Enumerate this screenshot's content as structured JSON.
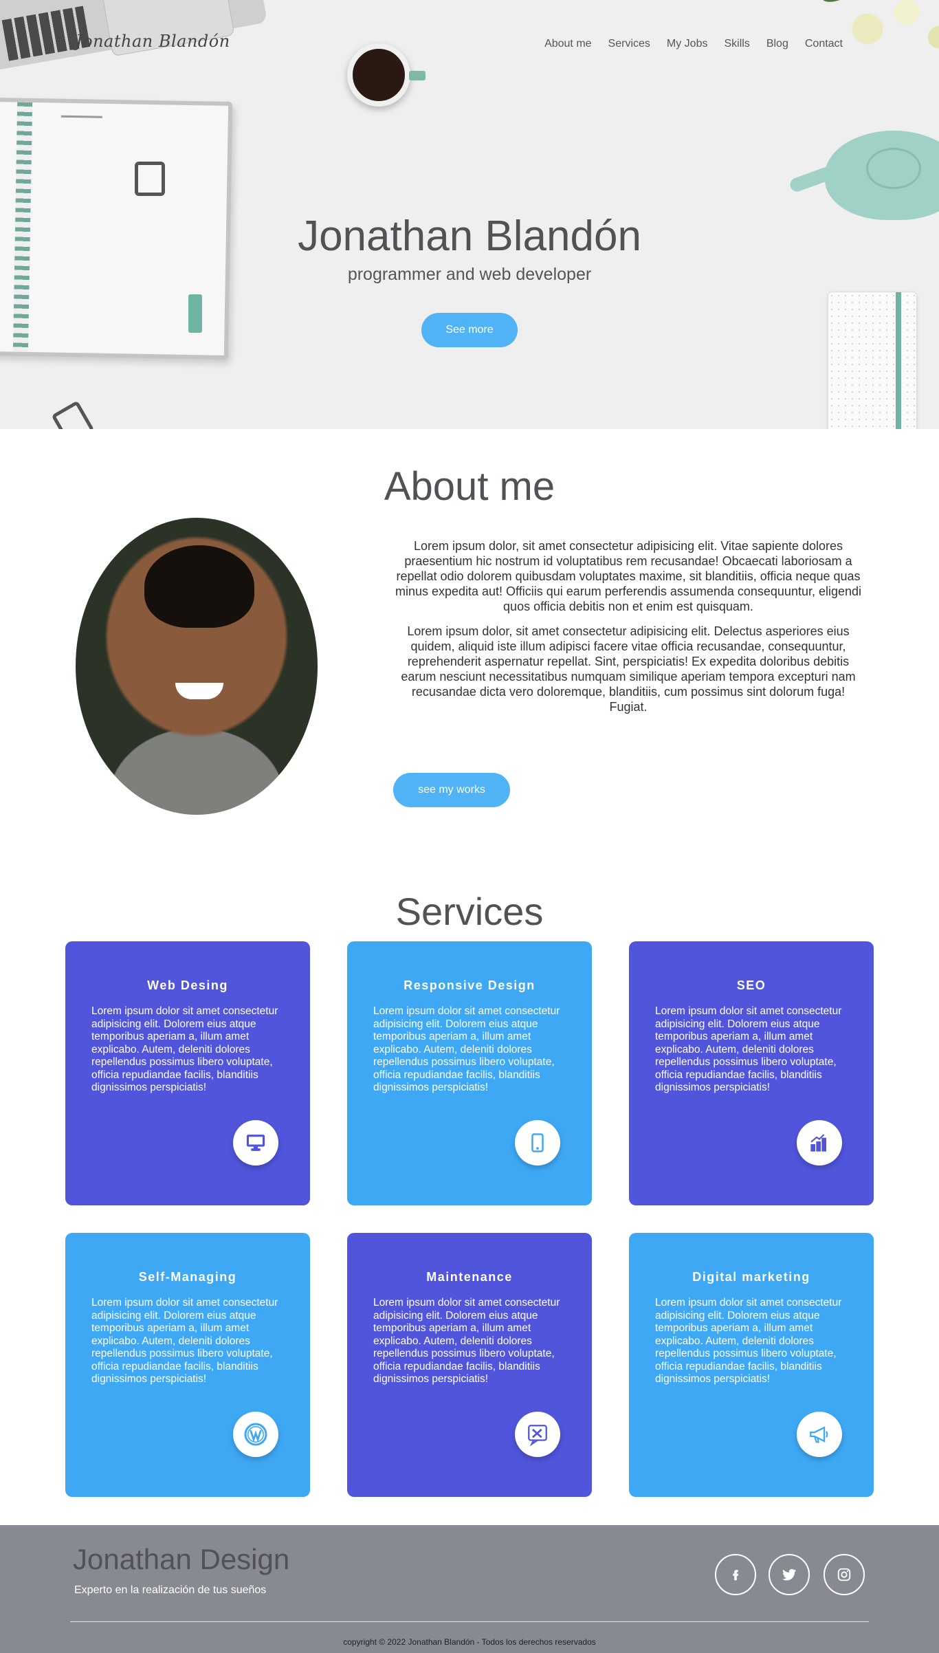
{
  "header": {
    "logo": "Jonathan Blandón",
    "nav": [
      "About me",
      "Services",
      "My Jobs",
      "Skills",
      "Blog",
      "Contact"
    ]
  },
  "hero": {
    "title": "Jonathan Blandón",
    "subtitle": "programmer and web developer",
    "button": "See more"
  },
  "about": {
    "title": "About me",
    "paragraphs": [
      "Lorem ipsum dolor, sit amet consectetur adipisicing elit. Vitae sapiente dolores praesentium hic nostrum id voluptatibus rem recusandae! Obcaecati laboriosam a repellat odio dolorem quibusdam voluptates maxime, sit blanditiis, officia neque quas minus expedita aut! Officiis qui earum perferendis assumenda consequuntur, eligendi quos officia debitis non et enim est quisquam.",
      "Lorem ipsum dolor, sit amet consectetur adipisicing elit. Delectus asperiores eius quidem, aliquid iste illum adipisci facere vitae officia recusandae, consequuntur, reprehenderit aspernatur repellat. Sint, perspiciatis! Ex expedita doloribus debitis earum nesciunt necessitatibus numquam similique aperiam tempora excepturi nam recusandae dicta vero doloremque, blanditiis, cum possimus sint dolorum fuga! Fugiat."
    ],
    "button": "see my works"
  },
  "services": {
    "title": "Services",
    "cards": [
      {
        "title": "Web Desing",
        "text": "Lorem ipsum dolor sit amet consectetur adipisicing elit. Dolorem eius atque temporibus aperiam a, illum amet explicabo. Autem, deleniti dolores repellendus possimus libero voluptate, officia repudiandae facilis, blanditiis dignissimos perspiciatis!",
        "icon": "monitor-icon",
        "color": "#5055dc"
      },
      {
        "title": "Responsive Design",
        "text": "Lorem ipsum dolor sit amet consectetur adipisicing elit. Dolorem eius atque temporibus aperiam a, illum amet explicabo. Autem, deleniti dolores repellendus possimus libero voluptate, officia repudiandae facilis, blanditiis dignissimos perspiciatis!",
        "icon": "smartphone-icon",
        "color": "#3ea8f5"
      },
      {
        "title": "SEO",
        "text": "Lorem ipsum dolor sit amet consectetur adipisicing elit. Dolorem eius atque temporibus aperiam a, illum amet explicabo. Autem, deleniti dolores repellendus possimus libero voluptate, officia repudiandae facilis, blanditiis dignissimos perspiciatis!",
        "icon": "growth-chart-icon",
        "color": "#5055dc"
      },
      {
        "title": "Self-Managing",
        "text": "Lorem ipsum dolor sit amet consectetur adipisicing elit. Dolorem eius atque temporibus aperiam a, illum amet explicabo. Autem, deleniti dolores repellendus possimus libero voluptate, officia repudiandae facilis, blanditiis dignissimos perspiciatis!",
        "icon": "wordpress-icon",
        "color": "#3ea8f5"
      },
      {
        "title": "Maintenance",
        "text": "Lorem ipsum dolor sit amet consectetur adipisicing elit. Dolorem eius atque temporibus aperiam a, illum amet explicabo. Autem, deleniti dolores repellendus possimus libero voluptate, officia repudiandae facilis, blanditiis dignissimos perspiciatis!",
        "icon": "tools-icon",
        "color": "#5055dc"
      },
      {
        "title": "Digital marketing",
        "text": "Lorem ipsum dolor sit amet consectetur adipisicing elit. Dolorem eius atque temporibus aperiam a, illum amet explicabo. Autem, deleniti dolores repellendus possimus libero voluptate, officia repudiandae facilis, blanditiis dignissimos perspiciatis!",
        "icon": "megaphone-icon",
        "color": "#3ea8f5"
      }
    ]
  },
  "footer": {
    "brand": "Jonathan Design",
    "tagline": "Experto en la realización de tus sueños",
    "social": [
      "facebook-icon",
      "twitter-icon",
      "instagram-icon"
    ],
    "copyright": "copyright © 2022 Jonathan Blandón - Todos los derechos reservados",
    "background": "#878a91"
  },
  "colors": {
    "accent": "#4fb3f5",
    "purple": "#5055dc",
    "blue": "#3ea8f5"
  }
}
